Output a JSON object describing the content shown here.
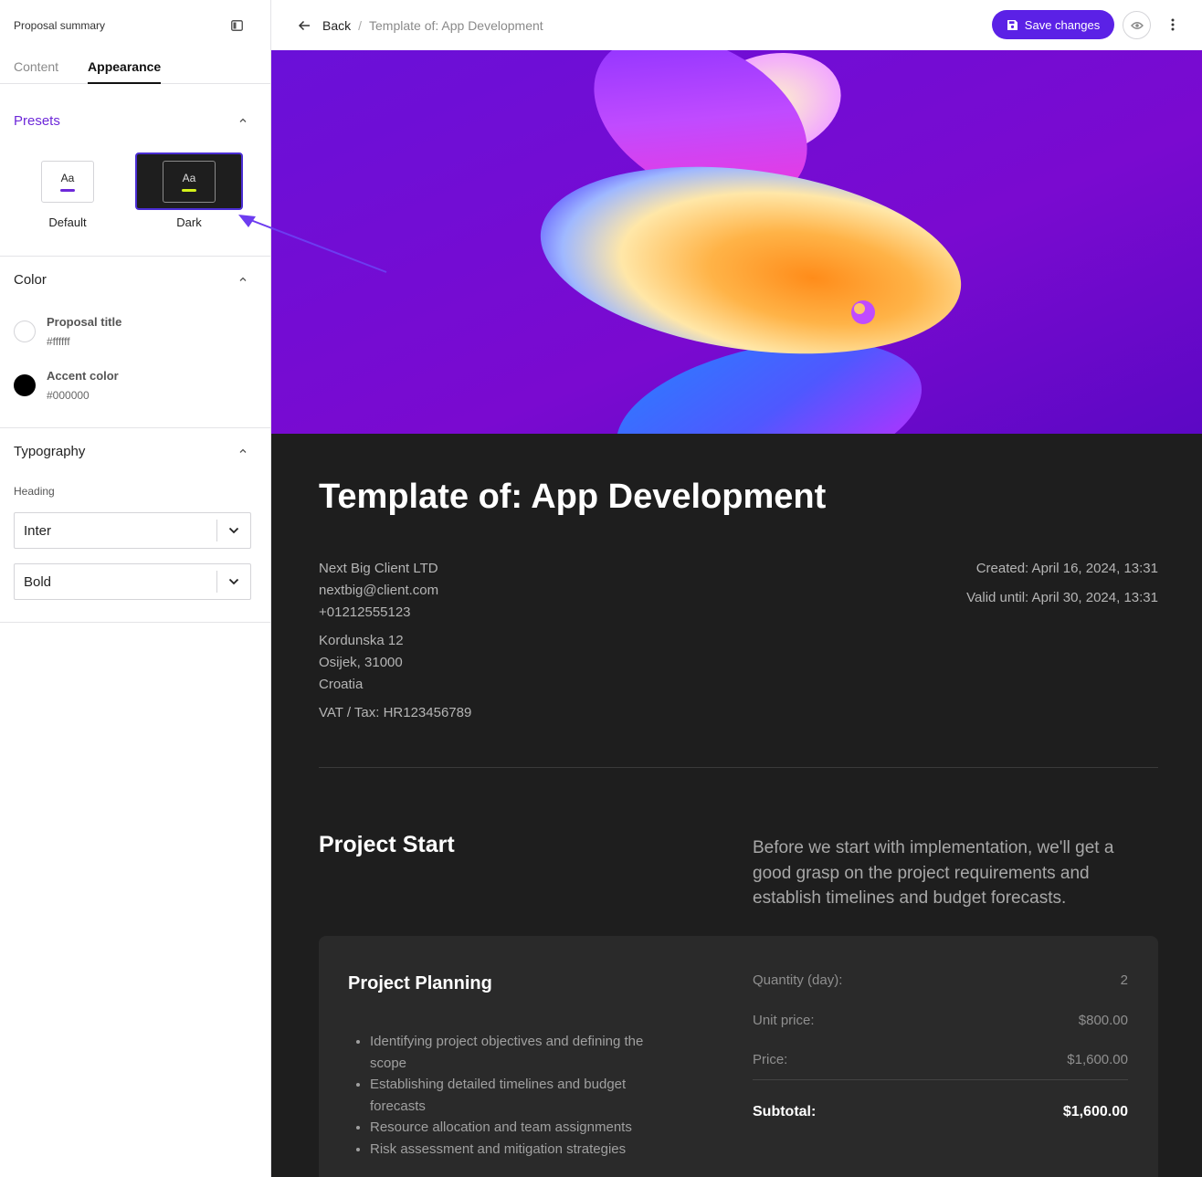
{
  "sidebar": {
    "title": "Proposal summary",
    "tabs": [
      {
        "label": "Content",
        "active": false
      },
      {
        "label": "Appearance",
        "active": true
      }
    ],
    "presets": {
      "title": "Presets",
      "items": [
        {
          "label": "Default",
          "glyph": "Aa",
          "selected": false
        },
        {
          "label": "Dark",
          "glyph": "Aa",
          "selected": true
        }
      ]
    },
    "color": {
      "title": "Color",
      "items": [
        {
          "name": "Proposal title",
          "hex": "#ffffff"
        },
        {
          "name": "Accent color",
          "hex": "#000000"
        }
      ]
    },
    "typography": {
      "title": "Typography",
      "heading_label": "Heading",
      "font_value": "Inter",
      "weight_value": "Bold"
    }
  },
  "topbar": {
    "back_label": "Back",
    "separator": "/",
    "current": "Template of: App Development",
    "save_label": "Save changes"
  },
  "document": {
    "title": "Template of: App Development",
    "client": {
      "name": "Next Big Client LTD",
      "email": "nextbig@client.com",
      "phone": "+01212555123",
      "street": "Kordunska 12",
      "city": "Osijek, 31000",
      "country": "Croatia",
      "vat": "VAT / Tax: HR123456789"
    },
    "created": "Created: April 16, 2024, 13:31",
    "valid_until": "Valid until: April 30, 2024, 13:31",
    "section": {
      "title": "Project Start",
      "description": "Before we start with implementation, we'll get a good grasp on the project requirements and establish timelines and budget forecasts."
    },
    "item": {
      "title": "Project Planning",
      "bullets": [
        "Identifying project objectives and defining the scope",
        "Establishing detailed timelines and budget forecasts",
        "Resource allocation and team assignments",
        "Risk assessment and mitigation strategies"
      ],
      "quantity_label": "Quantity (day):",
      "quantity_value": "2",
      "unit_price_label": "Unit price:",
      "unit_price_value": "$800.00",
      "price_label": "Price:",
      "price_value": "$1,600.00",
      "subtotal_label": "Subtotal:",
      "subtotal_value": "$1,600.00"
    }
  },
  "colors": {
    "accent": "#5b21e6",
    "presets_title": "#6d28d9",
    "doc_bg": "#1e1e1e",
    "card_bg": "#2a2a2a",
    "dark_preset_bar": "#d4f21a"
  },
  "icons": [
    "panel-toggle-icon",
    "chevron-up-icon",
    "chevron-down-icon",
    "arrow-left-icon",
    "save-icon",
    "eye-icon",
    "more-vertical-icon",
    "annotation-arrow-icon"
  ]
}
